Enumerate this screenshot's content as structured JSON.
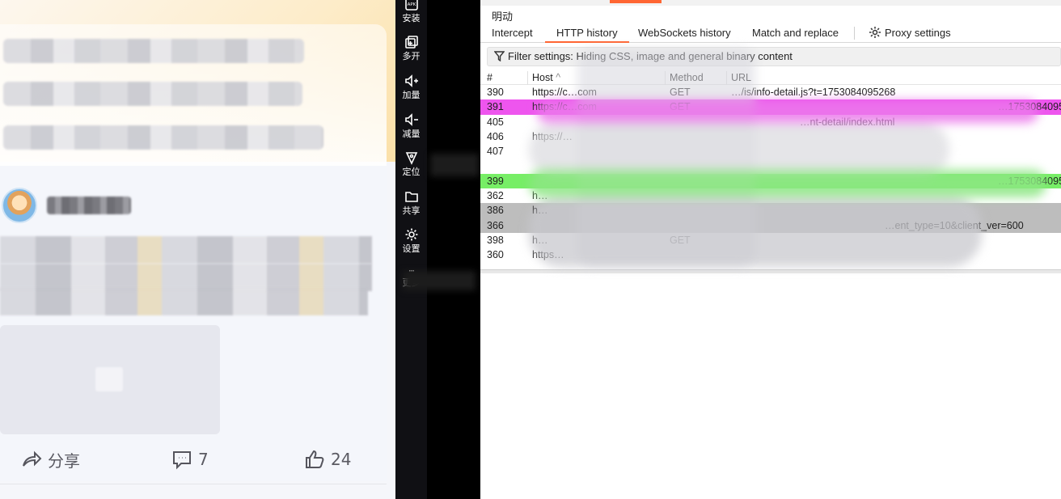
{
  "toolbar": {
    "items": [
      {
        "label": "安装",
        "badge": "APK"
      },
      {
        "label": "多开"
      },
      {
        "label": "加量"
      },
      {
        "label": "减量"
      },
      {
        "label": "定位"
      },
      {
        "label": "共享"
      },
      {
        "label": "设置"
      },
      {
        "label": "更多"
      }
    ]
  },
  "feed": {
    "actions": {
      "share_label": "分享",
      "comment_count": "7",
      "like_count": "24"
    }
  },
  "burp": {
    "menu_label": "明动",
    "subtabs": [
      "Intercept",
      "HTTP history",
      "WebSockets history",
      "Match and replace",
      "Proxy settings"
    ],
    "active_subtab": "HTTP history",
    "filter_text": "Filter settings: Hiding CSS, image and general binary content",
    "columns": [
      "#",
      "Host",
      "Method",
      "URL"
    ],
    "rows": [
      {
        "num": "390",
        "host": "https://c…com",
        "method": "GET",
        "url": "…/is/info-detail.js?t=1753084095268",
        "highlight": "none"
      },
      {
        "num": "391",
        "host": "https://c…com",
        "method": "GET",
        "url": "…1753084095",
        "highlight": "magenta"
      },
      {
        "num": "405",
        "host": "",
        "method": "",
        "url": "…nt-detail/index.html",
        "highlight": "none"
      },
      {
        "num": "406",
        "host": "https://…",
        "method": "",
        "url": "",
        "highlight": "none"
      },
      {
        "num": "407",
        "host": "",
        "method": "",
        "url": "",
        "highlight": "none"
      },
      {
        "num": "",
        "host": "",
        "method": "",
        "url": "",
        "highlight": "none"
      },
      {
        "num": "399",
        "host": "",
        "method": "",
        "url": "…1753084095",
        "highlight": "green"
      },
      {
        "num": "362",
        "host": "h…",
        "method": "",
        "url": "",
        "highlight": "none"
      },
      {
        "num": "386",
        "host": "h…",
        "method": "",
        "url": "",
        "highlight": "gray"
      },
      {
        "num": "366",
        "host": "",
        "method": "",
        "url": "…ent_type=10&client_ver=600",
        "highlight": "gray"
      },
      {
        "num": "398",
        "host": "h…",
        "method": "GET",
        "url": "",
        "highlight": "none"
      },
      {
        "num": "360",
        "host": "https…",
        "method": "",
        "url": "",
        "highlight": "none"
      }
    ]
  }
}
